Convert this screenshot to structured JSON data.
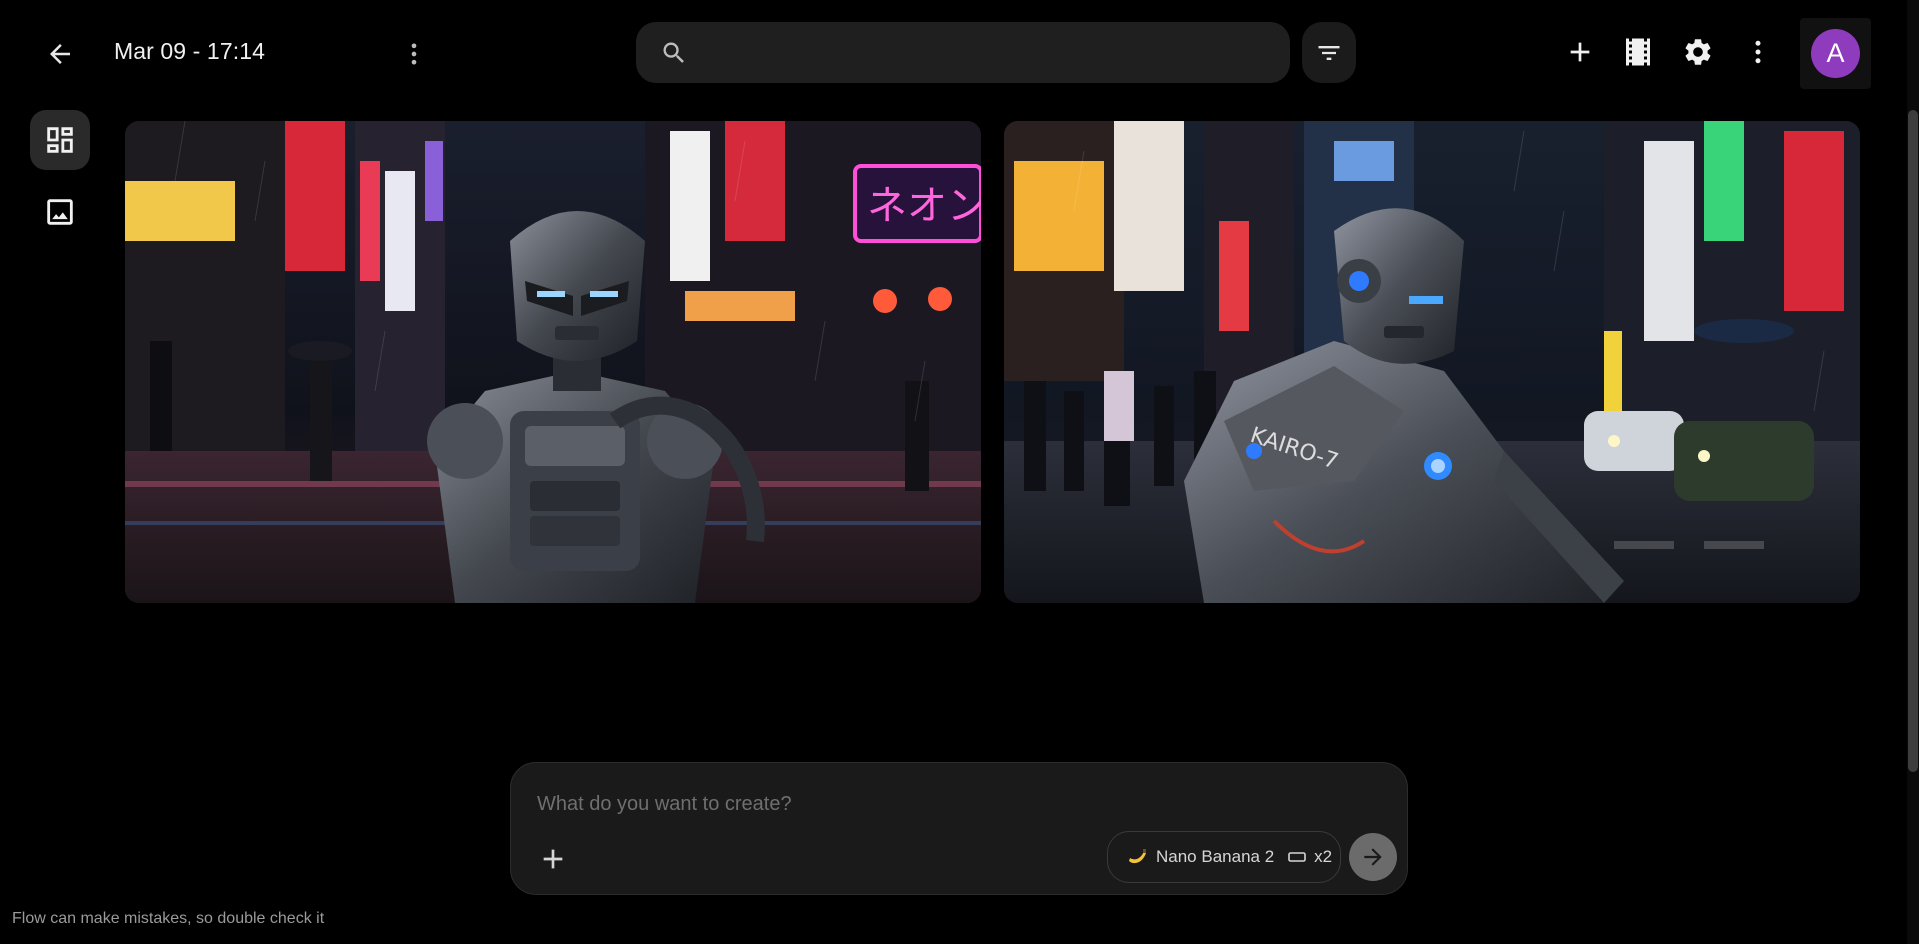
{
  "header": {
    "title": "Mar 09 - 17:14",
    "search_placeholder": "",
    "avatar_initial": "A"
  },
  "icons": {
    "back": "arrow-back-icon",
    "title_more": "more-vert-icon",
    "search": "search-icon",
    "filter": "filter-list-icon",
    "add": "add-icon",
    "scenes": "film-strip-icon",
    "settings": "gear-icon",
    "more": "more-vert-icon",
    "rail_grid": "dashboard-icon",
    "rail_image": "image-icon",
    "attach": "add-icon",
    "model": "banana-emoji",
    "aspect": "landscape-ratio-icon",
    "send": "arrow-forward-icon"
  },
  "colors": {
    "background": "#000000",
    "avatar": "#8e3cbd",
    "surface": "#1f1f1f"
  },
  "gallery": {
    "images": [
      {
        "name": "robot-neon-street-front",
        "sign_text": "ネオン"
      },
      {
        "name": "robot-kairo-7-crosswalk",
        "sign_text": "KAIRO-7"
      }
    ]
  },
  "composer": {
    "placeholder": "What do you want to create?",
    "model_name": "Nano Banana 2",
    "count": "x2"
  },
  "footer": {
    "disclaimer": "Flow can make mistakes, so double check it"
  }
}
